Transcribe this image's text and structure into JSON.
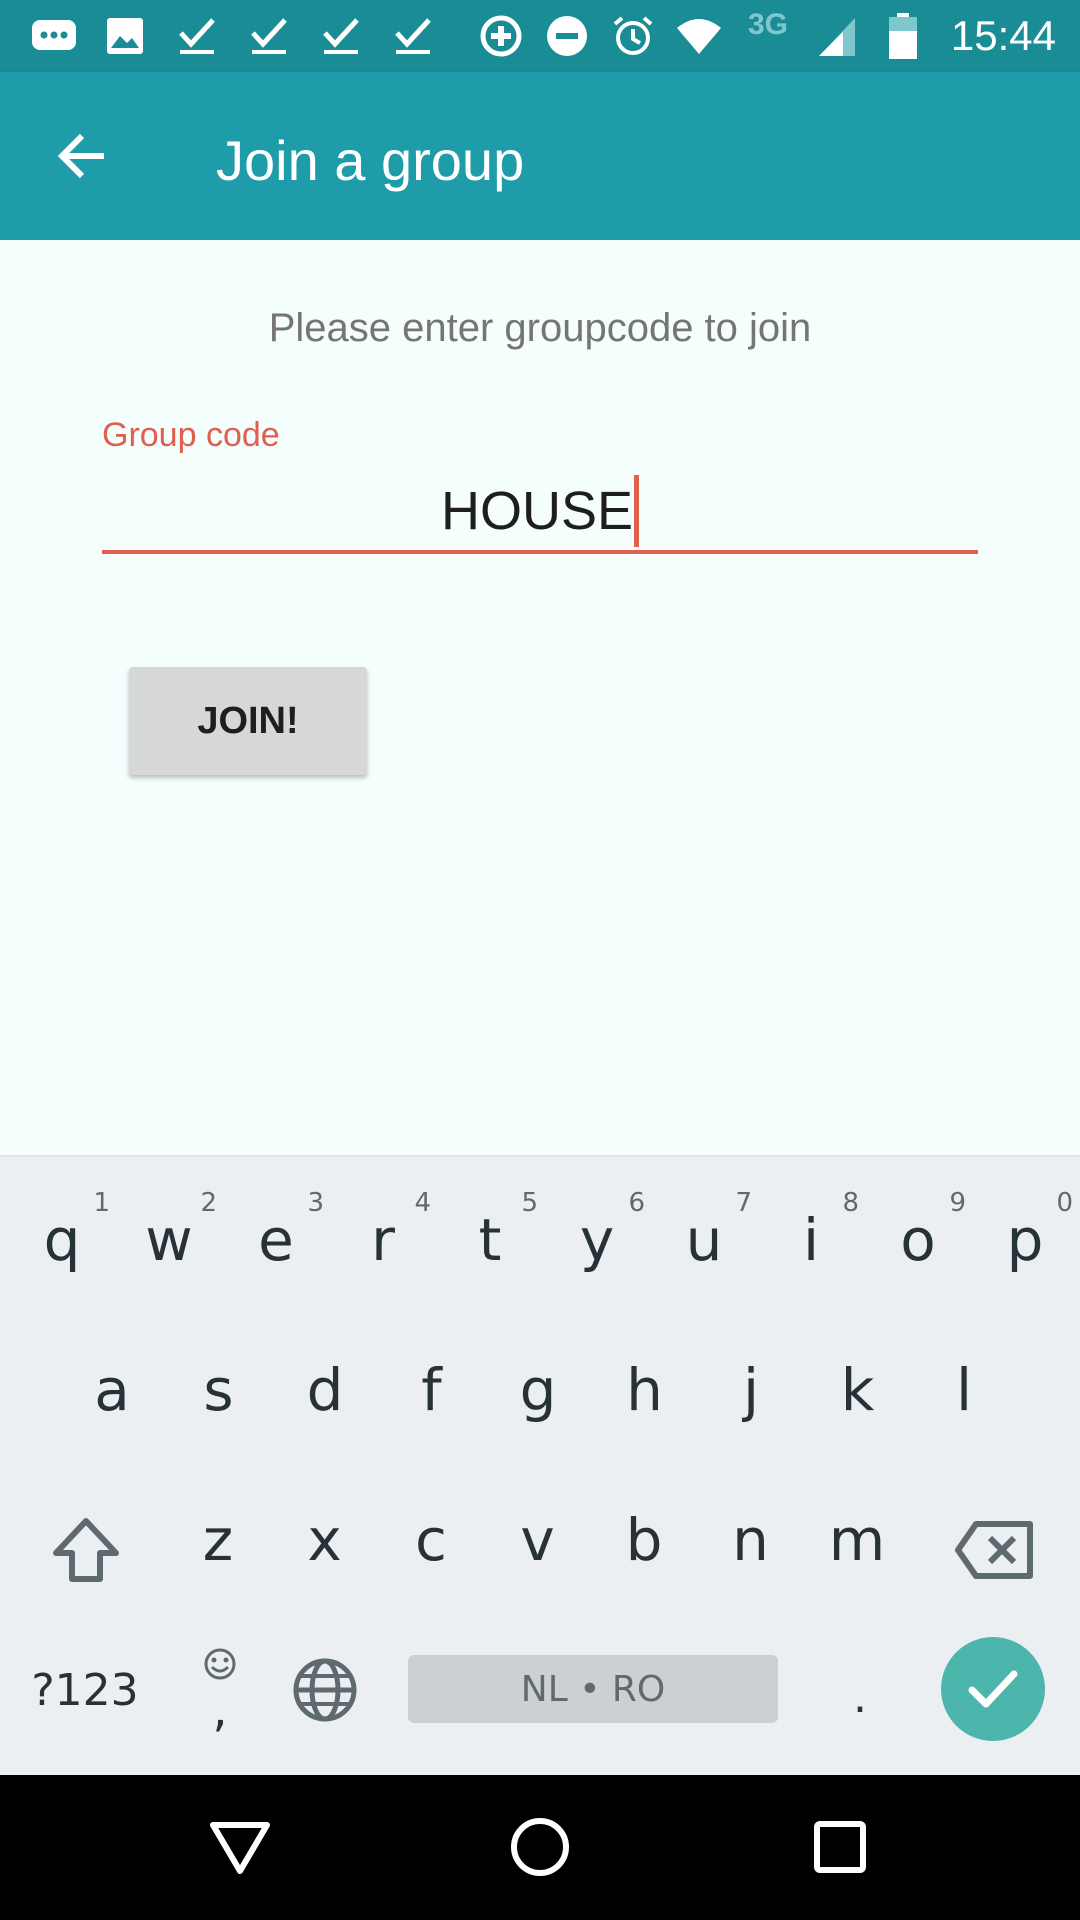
{
  "status_bar": {
    "time": "15:44",
    "network": "3G",
    "icons": [
      "message-icon",
      "image-icon",
      "check-icon",
      "check-icon",
      "check-icon",
      "check-icon",
      "data-saver-icon",
      "do-not-disturb-icon",
      "alarm-icon",
      "wifi-icon",
      "signal-icon",
      "battery-icon"
    ]
  },
  "app_bar": {
    "title": "Join a group",
    "back_icon": "arrow-back-icon"
  },
  "content": {
    "prompt": "Please enter groupcode to join",
    "group_code": {
      "label": "Group code",
      "value": "HOUSE"
    },
    "join_button": "JOIN!"
  },
  "keyboard": {
    "row1": [
      {
        "key": "q",
        "hint": "1"
      },
      {
        "key": "w",
        "hint": "2"
      },
      {
        "key": "e",
        "hint": "3"
      },
      {
        "key": "r",
        "hint": "4"
      },
      {
        "key": "t",
        "hint": "5"
      },
      {
        "key": "y",
        "hint": "6"
      },
      {
        "key": "u",
        "hint": "7"
      },
      {
        "key": "i",
        "hint": "8"
      },
      {
        "key": "o",
        "hint": "9"
      },
      {
        "key": "p",
        "hint": "0"
      }
    ],
    "row2": [
      "a",
      "s",
      "d",
      "f",
      "g",
      "h",
      "j",
      "k",
      "l"
    ],
    "row3": [
      "z",
      "x",
      "c",
      "v",
      "b",
      "n",
      "m"
    ],
    "symbols_key": "?123",
    "comma_key": ",",
    "period_key": ".",
    "space_label": "NL • RO",
    "shift_icon": "shift-icon",
    "backspace_icon": "backspace-icon",
    "emoji_icon": "emoji-icon",
    "globe_icon": "globe-icon",
    "enter_icon": "check-icon"
  },
  "nav_bar": {
    "icons": [
      "back-triangle-icon",
      "home-circle-icon",
      "recents-square-icon"
    ]
  },
  "colors": {
    "status_bar": "#1a8c96",
    "app_bar": "#1f9ca9",
    "accent": "#e0604d",
    "enter_key": "#4db6ac",
    "background": "#f3fefd"
  }
}
